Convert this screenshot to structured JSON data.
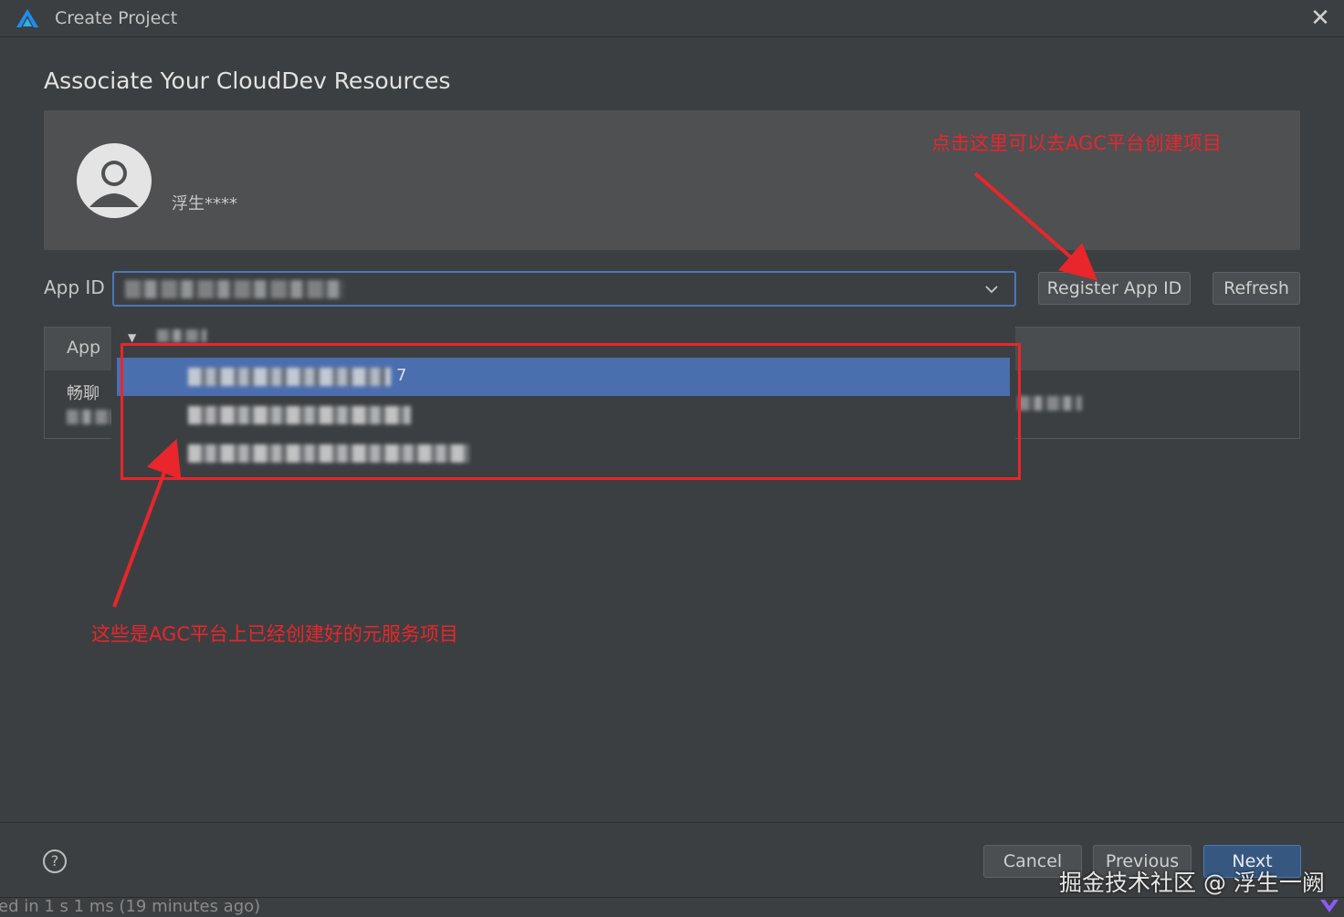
{
  "window": {
    "title": "Create Project",
    "close_glyph": "✕"
  },
  "page": {
    "heading": "Associate Your CloudDev Resources"
  },
  "account": {
    "username": "浮生****"
  },
  "annotations": {
    "top": "点击这里可以去AGC平台创建项目",
    "bottom": "这些是AGC平台上已经创建好的元服务项目",
    "color": "#e8262b"
  },
  "app_id": {
    "label": "App ID",
    "register_label": "Register App ID",
    "refresh_label": "Refresh"
  },
  "table": {
    "header_app": "App",
    "row_app": "畅聊"
  },
  "dropdown": {
    "items": [
      {
        "suffix": "7",
        "selected": true
      },
      {
        "suffix": "",
        "selected": false
      },
      {
        "suffix": "",
        "selected": false
      }
    ]
  },
  "footer": {
    "help_glyph": "?",
    "cancel_label": "Cancel",
    "previous_label": "Previous",
    "next_label": "Next"
  },
  "status": {
    "text": "ed in 1 s 1 ms (19 minutes ago)"
  },
  "watermark": {
    "text": "掘金技术社区 @ 浮生一阙"
  },
  "colors": {
    "background": "#3c3f41",
    "panel": "#4e5052",
    "selection": "#4b6eaf",
    "accent_border": "#4a78b8",
    "primary_button": "#365880"
  }
}
